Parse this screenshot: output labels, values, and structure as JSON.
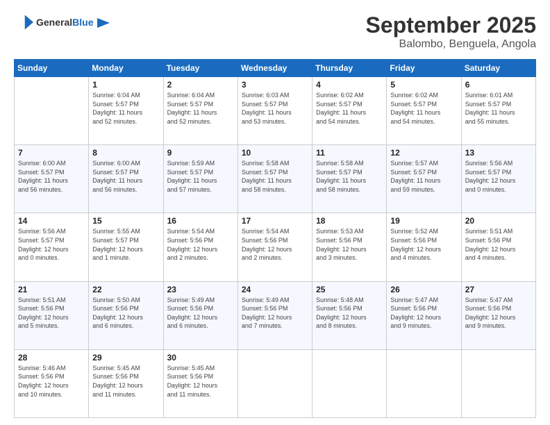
{
  "header": {
    "logo_general": "General",
    "logo_blue": "Blue",
    "title": "September 2025",
    "subtitle": "Balombo, Benguela, Angola"
  },
  "calendar": {
    "headers": [
      "Sunday",
      "Monday",
      "Tuesday",
      "Wednesday",
      "Thursday",
      "Friday",
      "Saturday"
    ],
    "weeks": [
      [
        {
          "day": "",
          "info": ""
        },
        {
          "day": "1",
          "info": "Sunrise: 6:04 AM\nSunset: 5:57 PM\nDaylight: 11 hours\nand 52 minutes."
        },
        {
          "day": "2",
          "info": "Sunrise: 6:04 AM\nSunset: 5:57 PM\nDaylight: 11 hours\nand 52 minutes."
        },
        {
          "day": "3",
          "info": "Sunrise: 6:03 AM\nSunset: 5:57 PM\nDaylight: 11 hours\nand 53 minutes."
        },
        {
          "day": "4",
          "info": "Sunrise: 6:02 AM\nSunset: 5:57 PM\nDaylight: 11 hours\nand 54 minutes."
        },
        {
          "day": "5",
          "info": "Sunrise: 6:02 AM\nSunset: 5:57 PM\nDaylight: 11 hours\nand 54 minutes."
        },
        {
          "day": "6",
          "info": "Sunrise: 6:01 AM\nSunset: 5:57 PM\nDaylight: 11 hours\nand 55 minutes."
        }
      ],
      [
        {
          "day": "7",
          "info": "Sunrise: 6:00 AM\nSunset: 5:57 PM\nDaylight: 11 hours\nand 56 minutes."
        },
        {
          "day": "8",
          "info": "Sunrise: 6:00 AM\nSunset: 5:57 PM\nDaylight: 11 hours\nand 56 minutes."
        },
        {
          "day": "9",
          "info": "Sunrise: 5:59 AM\nSunset: 5:57 PM\nDaylight: 11 hours\nand 57 minutes."
        },
        {
          "day": "10",
          "info": "Sunrise: 5:58 AM\nSunset: 5:57 PM\nDaylight: 11 hours\nand 58 minutes."
        },
        {
          "day": "11",
          "info": "Sunrise: 5:58 AM\nSunset: 5:57 PM\nDaylight: 11 hours\nand 58 minutes."
        },
        {
          "day": "12",
          "info": "Sunrise: 5:57 AM\nSunset: 5:57 PM\nDaylight: 11 hours\nand 59 minutes."
        },
        {
          "day": "13",
          "info": "Sunrise: 5:56 AM\nSunset: 5:57 PM\nDaylight: 12 hours\nand 0 minutes."
        }
      ],
      [
        {
          "day": "14",
          "info": "Sunrise: 5:56 AM\nSunset: 5:57 PM\nDaylight: 12 hours\nand 0 minutes."
        },
        {
          "day": "15",
          "info": "Sunrise: 5:55 AM\nSunset: 5:57 PM\nDaylight: 12 hours\nand 1 minute."
        },
        {
          "day": "16",
          "info": "Sunrise: 5:54 AM\nSunset: 5:56 PM\nDaylight: 12 hours\nand 2 minutes."
        },
        {
          "day": "17",
          "info": "Sunrise: 5:54 AM\nSunset: 5:56 PM\nDaylight: 12 hours\nand 2 minutes."
        },
        {
          "day": "18",
          "info": "Sunrise: 5:53 AM\nSunset: 5:56 PM\nDaylight: 12 hours\nand 3 minutes."
        },
        {
          "day": "19",
          "info": "Sunrise: 5:52 AM\nSunset: 5:56 PM\nDaylight: 12 hours\nand 4 minutes."
        },
        {
          "day": "20",
          "info": "Sunrise: 5:51 AM\nSunset: 5:56 PM\nDaylight: 12 hours\nand 4 minutes."
        }
      ],
      [
        {
          "day": "21",
          "info": "Sunrise: 5:51 AM\nSunset: 5:56 PM\nDaylight: 12 hours\nand 5 minutes."
        },
        {
          "day": "22",
          "info": "Sunrise: 5:50 AM\nSunset: 5:56 PM\nDaylight: 12 hours\nand 6 minutes."
        },
        {
          "day": "23",
          "info": "Sunrise: 5:49 AM\nSunset: 5:56 PM\nDaylight: 12 hours\nand 6 minutes."
        },
        {
          "day": "24",
          "info": "Sunrise: 5:49 AM\nSunset: 5:56 PM\nDaylight: 12 hours\nand 7 minutes."
        },
        {
          "day": "25",
          "info": "Sunrise: 5:48 AM\nSunset: 5:56 PM\nDaylight: 12 hours\nand 8 minutes."
        },
        {
          "day": "26",
          "info": "Sunrise: 5:47 AM\nSunset: 5:56 PM\nDaylight: 12 hours\nand 9 minutes."
        },
        {
          "day": "27",
          "info": "Sunrise: 5:47 AM\nSunset: 5:56 PM\nDaylight: 12 hours\nand 9 minutes."
        }
      ],
      [
        {
          "day": "28",
          "info": "Sunrise: 5:46 AM\nSunset: 5:56 PM\nDaylight: 12 hours\nand 10 minutes."
        },
        {
          "day": "29",
          "info": "Sunrise: 5:45 AM\nSunset: 5:56 PM\nDaylight: 12 hours\nand 11 minutes."
        },
        {
          "day": "30",
          "info": "Sunrise: 5:45 AM\nSunset: 5:56 PM\nDaylight: 12 hours\nand 11 minutes."
        },
        {
          "day": "",
          "info": ""
        },
        {
          "day": "",
          "info": ""
        },
        {
          "day": "",
          "info": ""
        },
        {
          "day": "",
          "info": ""
        }
      ]
    ]
  }
}
